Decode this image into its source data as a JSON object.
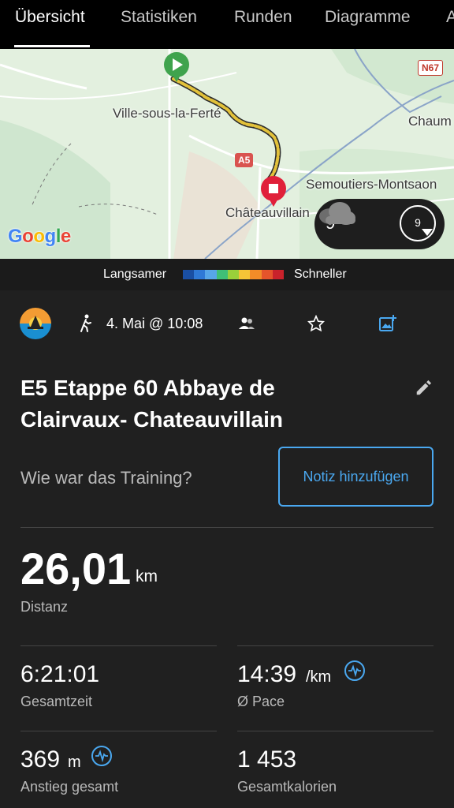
{
  "tabs": [
    {
      "label": "Übersicht",
      "active": true
    },
    {
      "label": "Statistiken",
      "active": false
    },
    {
      "label": "Runden",
      "active": false
    },
    {
      "label": "Diagramme",
      "active": false
    },
    {
      "label": "A",
      "active": false
    }
  ],
  "map": {
    "labels": {
      "town1": "Ville-sous-la-Ferté",
      "town2": "Chaum",
      "town3": "Semoutiers-Montsaon",
      "town4": "Châteauvillain",
      "road_a5": "A5",
      "road_n67": "N67"
    },
    "google_logo": "Google",
    "weather": {
      "temperature": "9°",
      "wind": "9"
    }
  },
  "legend": {
    "slower": "Langsamer",
    "faster": "Schneller",
    "colors": [
      "#1a4fa3",
      "#2f79d6",
      "#57a6e8",
      "#3fbf76",
      "#9ad03a",
      "#f5c437",
      "#f28c28",
      "#e5542b",
      "#c9222b"
    ]
  },
  "activity": {
    "date": "4. Mai @ 10:08",
    "title": "E5 Etappe 60 Abbaye de Clairvaux- Chateauvillain",
    "question": "Wie war das Training?",
    "note_button": "Notiz hinzufügen"
  },
  "stats": {
    "distance": {
      "value": "26,01",
      "unit": "km",
      "label": "Distanz"
    },
    "total_time": {
      "value": "6:21:01",
      "label": "Gesamtzeit"
    },
    "pace": {
      "value": "14:39",
      "unit": "/km",
      "label": "Ø Pace"
    },
    "ascent": {
      "value": "369",
      "unit": "m",
      "label": "Anstieg gesamt"
    },
    "calories": {
      "value": "1 453",
      "label": "Gesamtkalorien"
    }
  },
  "accent_color": "#4aa8f0"
}
